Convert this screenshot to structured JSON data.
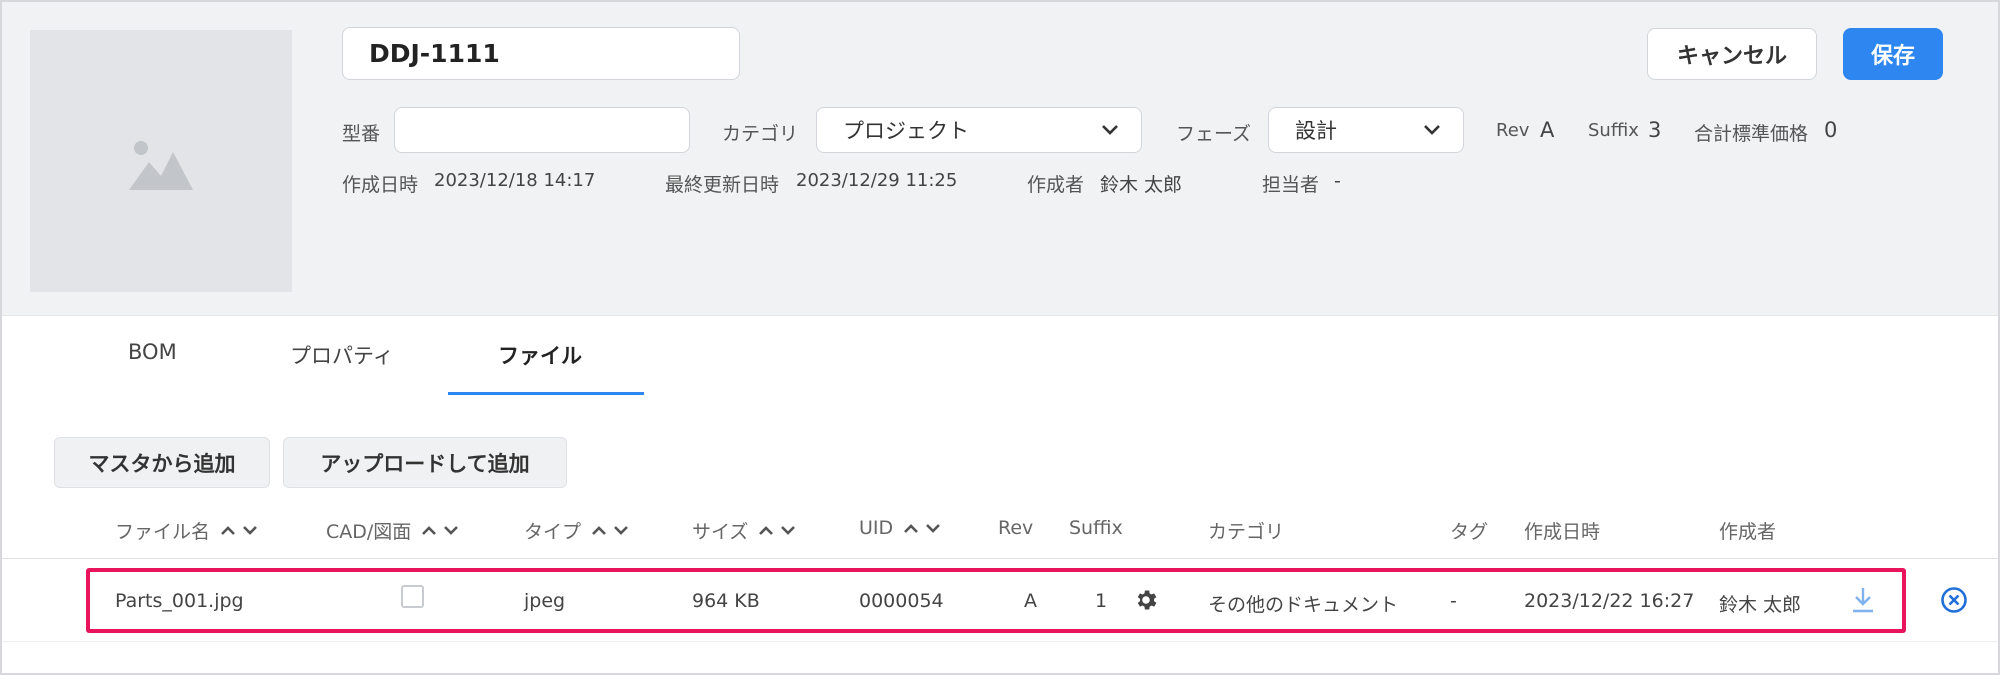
{
  "header": {
    "item_name": "DDJ-1111",
    "cancel_label": "キャンセル",
    "save_label": "保存",
    "model_label": "型番",
    "model_value": "",
    "category_label": "カテゴリ",
    "category_value": "プロジェクト",
    "phase_label": "フェーズ",
    "phase_value": "設計",
    "rev_label": "Rev",
    "rev_value": "A",
    "suffix_label": "Suffix",
    "suffix_value": "3",
    "total_price_label": "合計標準価格",
    "total_price_value": "0",
    "created_label": "作成日時",
    "created_value": "2023/12/18 14:17",
    "updated_label": "最終更新日時",
    "updated_value": "2023/12/29 11:25",
    "creator_label": "作成者",
    "creator_value": "鈴木 太郎",
    "assignee_label": "担当者",
    "assignee_value": "-"
  },
  "tabs": [
    {
      "label": "BOM",
      "active": false
    },
    {
      "label": "プロパティ",
      "active": false
    },
    {
      "label": "ファイル",
      "active": true
    }
  ],
  "actions": {
    "add_from_master": "マスタから追加",
    "upload_add": "アップロードして追加"
  },
  "table": {
    "columns": [
      "ファイル名",
      "CAD/図面",
      "タイプ",
      "サイズ",
      "UID",
      "Rev",
      "Suffix",
      "カテゴリ",
      "タグ",
      "作成日時",
      "作成者"
    ],
    "rows": [
      {
        "filename": "Parts_001.jpg",
        "cad": false,
        "type": "jpeg",
        "size": "964 KB",
        "uid": "0000054",
        "rev": "A",
        "suffix": "1",
        "category": "その他のドキュメント",
        "tag": "-",
        "created": "2023/12/22 16:27",
        "creator": "鈴木 太郎"
      }
    ]
  },
  "colors": {
    "accent": "#2e86f0",
    "highlight": "#e8145c"
  }
}
